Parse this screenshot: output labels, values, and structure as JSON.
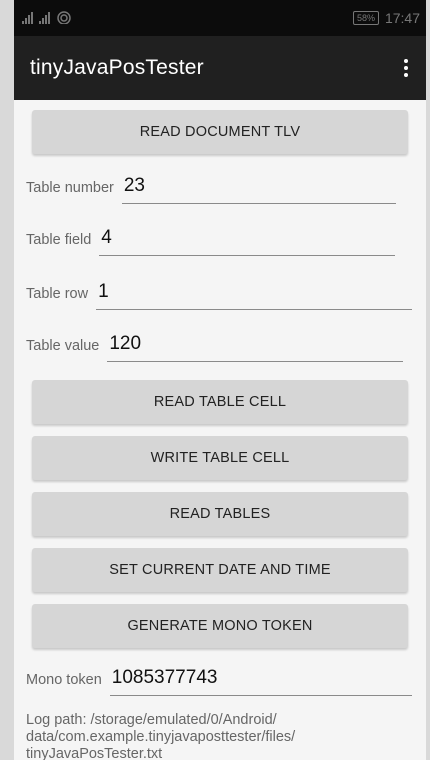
{
  "status_bar": {
    "time": "17:47",
    "battery": "58%"
  },
  "app_bar": {
    "title": "tinyJavaPosTester"
  },
  "buttons": {
    "read_document_tlv": "READ DOCUMENT TLV",
    "read_table_cell": "READ TABLE CELL",
    "write_table_cell": "WRITE TABLE CELL",
    "read_tables": "READ TABLES",
    "set_current_date_time": "SET CURRENT DATE AND TIME",
    "generate_mono_token": "GENERATE MONO TOKEN"
  },
  "fields": {
    "table_number": {
      "label": "Table number",
      "value": "23"
    },
    "table_field": {
      "label": "Table field",
      "value": "4"
    },
    "table_row": {
      "label": "Table row",
      "value": "1"
    },
    "table_value": {
      "label": "Table value",
      "value": "120"
    },
    "mono_token": {
      "label": "Mono token",
      "value": "1085377743"
    }
  },
  "log_path": {
    "line1": "Log path: /storage/emulated/0/Android/",
    "line2": "data/com.example.tinyjavaposttester/files/",
    "line3": "tinyJavaPosTester.txt"
  }
}
